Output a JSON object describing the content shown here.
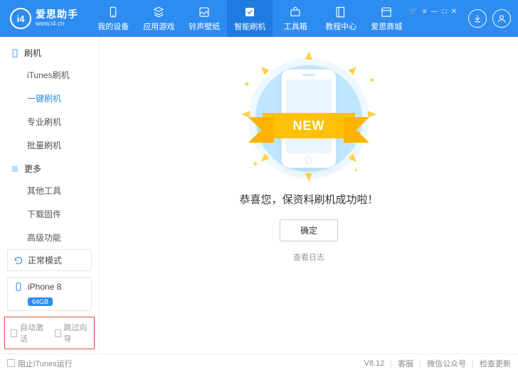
{
  "header": {
    "brand": "爱思助手",
    "url": "www.i4.cn"
  },
  "nav": [
    {
      "label": "我的设备"
    },
    {
      "label": "应用游戏"
    },
    {
      "label": "铃声壁纸"
    },
    {
      "label": "智能刷机"
    },
    {
      "label": "工具箱"
    },
    {
      "label": "教程中心"
    },
    {
      "label": "爱思商城"
    }
  ],
  "sidebar": {
    "groups": [
      {
        "title": "刷机",
        "items": [
          "iTunes刷机",
          "一键刷机",
          "专业刷机",
          "批量刷机"
        ]
      },
      {
        "title": "更多",
        "items": [
          "其他工具",
          "下载固件",
          "高级功能"
        ]
      }
    ],
    "mode": "正常模式",
    "device": {
      "name": "iPhone 8",
      "capacity": "64GB"
    },
    "options": [
      "自动激活",
      "跳过向导"
    ]
  },
  "main": {
    "ribbon": "NEW",
    "message": "恭喜您，保资料刷机成功啦！",
    "ok": "确定",
    "view_log": "查看日志"
  },
  "footer": {
    "block_itunes": "阻止iTunes运行",
    "version": "V8.12",
    "links": [
      "客服",
      "微信公众号",
      "检查更新"
    ]
  }
}
